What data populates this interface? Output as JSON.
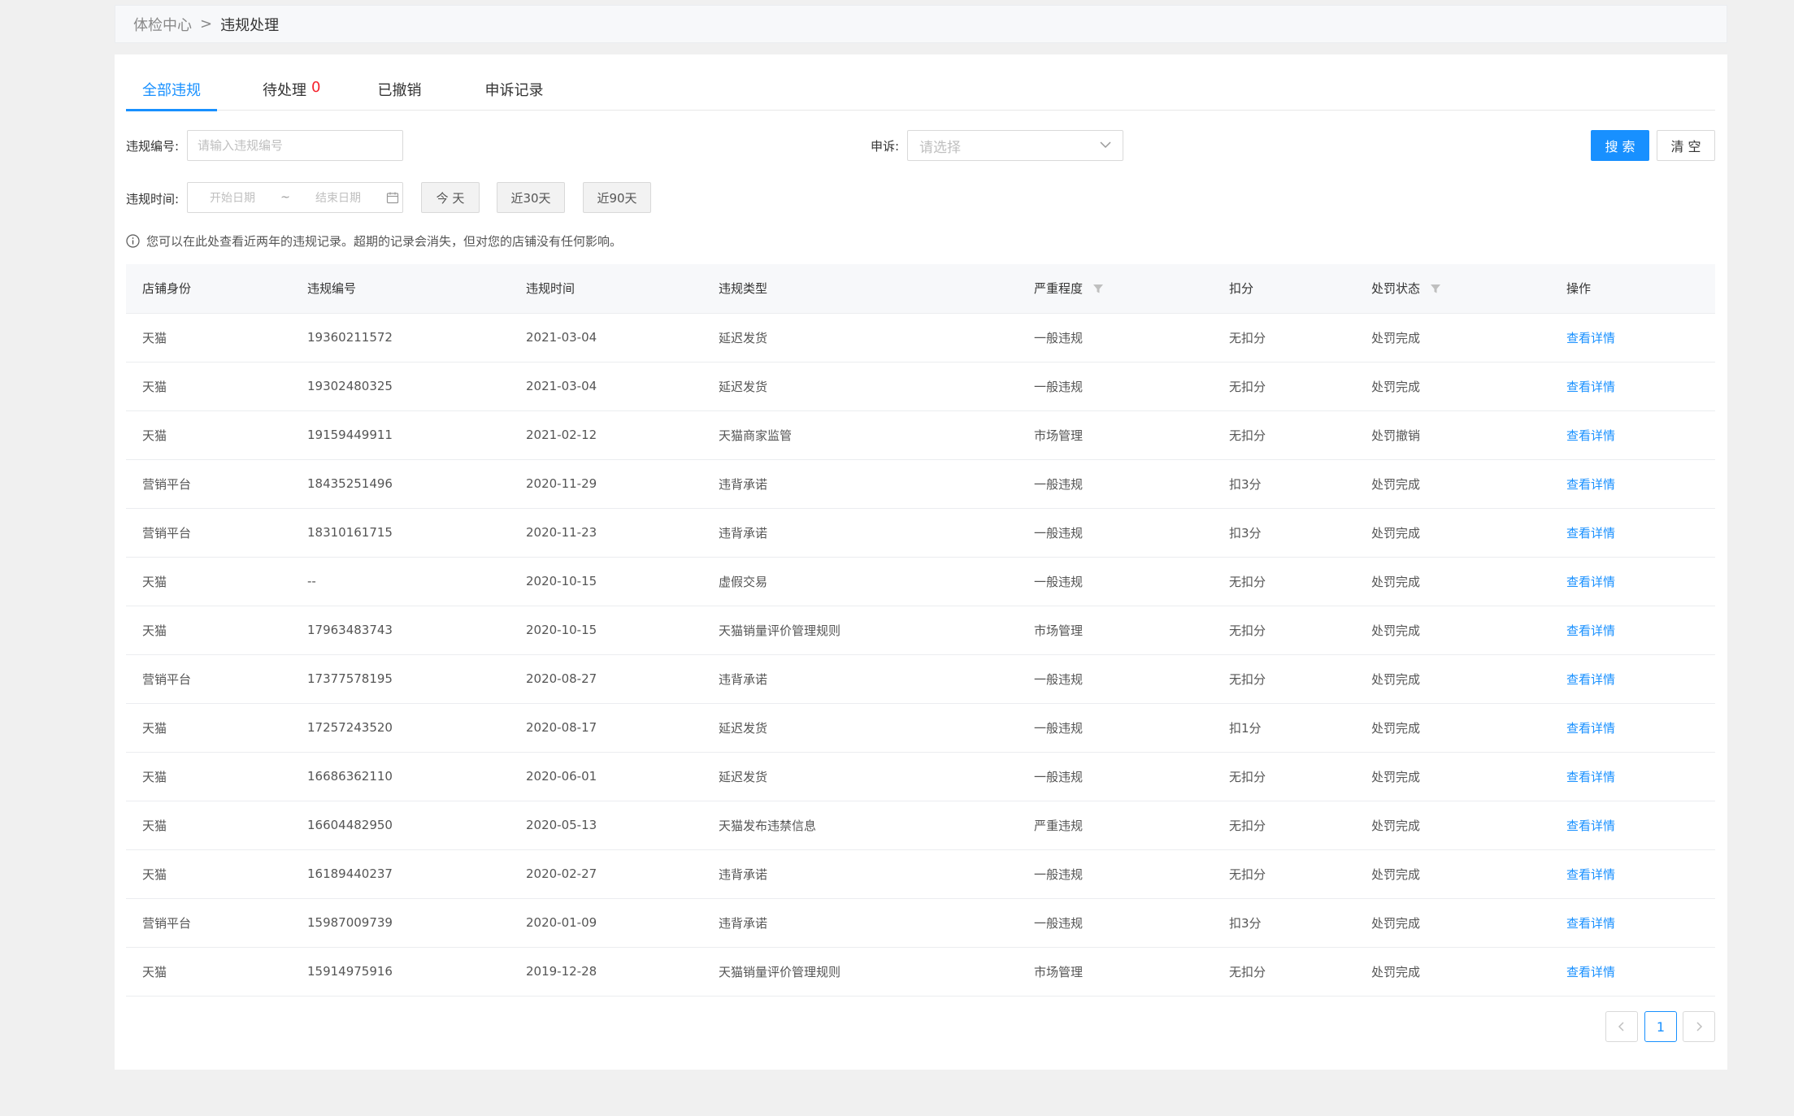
{
  "breadcrumb": {
    "root": "体检中心",
    "separator": ">",
    "current": "违规处理"
  },
  "tabs": [
    {
      "label": "全部违规",
      "count": ""
    },
    {
      "label": "待处理",
      "count": "0"
    },
    {
      "label": "已撤销",
      "count": ""
    },
    {
      "label": "申诉记录",
      "count": ""
    }
  ],
  "filters": {
    "violation_no_label": "违规编号:",
    "violation_no_placeholder": "请输入违规编号",
    "appeal_label": "申诉:",
    "appeal_placeholder": "请选择",
    "search_label": "搜 索",
    "clear_label": "清 空",
    "time_label": "违规时间:",
    "start_placeholder": "开始日期",
    "end_placeholder": "结束日期",
    "range_separator": "~",
    "today_label": "今 天",
    "last30_label": "近30天",
    "last90_label": "近90天"
  },
  "notice": "您可以在此处查看近两年的违规记录。超期的记录会消失，但对您的店铺没有任何影响。",
  "table": {
    "columns": [
      "店铺身份",
      "违规编号",
      "违规时间",
      "违规类型",
      "严重程度",
      "扣分",
      "处罚状态",
      "操作"
    ],
    "rows": [
      [
        "天猫",
        "19360211572",
        "2021-03-04",
        "延迟发货",
        "一般违规",
        "无扣分",
        "处罚完成",
        "查看详情"
      ],
      [
        "天猫",
        "19302480325",
        "2021-03-04",
        "延迟发货",
        "一般违规",
        "无扣分",
        "处罚完成",
        "查看详情"
      ],
      [
        "天猫",
        "19159449911",
        "2021-02-12",
        "天猫商家监管",
        "市场管理",
        "无扣分",
        "处罚撤销",
        "查看详情"
      ],
      [
        "营销平台",
        "18435251496",
        "2020-11-29",
        "违背承诺",
        "一般违规",
        "扣3分",
        "处罚完成",
        "查看详情"
      ],
      [
        "营销平台",
        "18310161715",
        "2020-11-23",
        "违背承诺",
        "一般违规",
        "扣3分",
        "处罚完成",
        "查看详情"
      ],
      [
        "天猫",
        "--",
        "2020-10-15",
        "虚假交易",
        "一般违规",
        "无扣分",
        "处罚完成",
        "查看详情"
      ],
      [
        "天猫",
        "17963483743",
        "2020-10-15",
        "天猫销量评价管理规则",
        "市场管理",
        "无扣分",
        "处罚完成",
        "查看详情"
      ],
      [
        "营销平台",
        "17377578195",
        "2020-08-27",
        "违背承诺",
        "一般违规",
        "无扣分",
        "处罚完成",
        "查看详情"
      ],
      [
        "天猫",
        "17257243520",
        "2020-08-17",
        "延迟发货",
        "一般违规",
        "扣1分",
        "处罚完成",
        "查看详情"
      ],
      [
        "天猫",
        "16686362110",
        "2020-06-01",
        "延迟发货",
        "一般违规",
        "无扣分",
        "处罚完成",
        "查看详情"
      ],
      [
        "天猫",
        "16604482950",
        "2020-05-13",
        "天猫发布违禁信息",
        "严重违规",
        "无扣分",
        "处罚完成",
        "查看详情"
      ],
      [
        "天猫",
        "16189440237",
        "2020-02-27",
        "违背承诺",
        "一般违规",
        "无扣分",
        "处罚完成",
        "查看详情"
      ],
      [
        "营销平台",
        "15987009739",
        "2020-01-09",
        "违背承诺",
        "一般违规",
        "扣3分",
        "处罚完成",
        "查看详情"
      ],
      [
        "天猫",
        "15914975916",
        "2019-12-28",
        "天猫销量评价管理规则",
        "市场管理",
        "无扣分",
        "处罚完成",
        "查看详情"
      ]
    ]
  },
  "pagination": {
    "prev": "<",
    "current": "1",
    "next": ">"
  },
  "icons": {
    "info": "info-icon",
    "calendar": "calendar-icon",
    "chevron": "chevron-down-icon",
    "filter": "filter-icon"
  },
  "colors": {
    "accent": "#1890ff",
    "danger": "#f5222d"
  }
}
